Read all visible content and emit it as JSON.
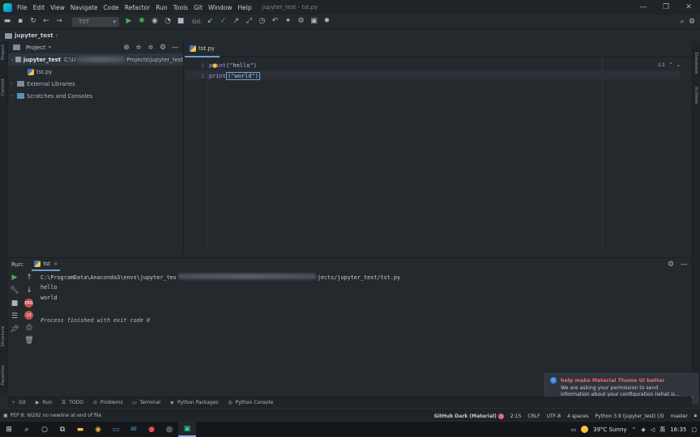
{
  "window": {
    "title": "jupyter_test - tst.py",
    "controls": [
      "—",
      "❐",
      "✕"
    ]
  },
  "menu": [
    "File",
    "Edit",
    "View",
    "Navigate",
    "Code",
    "Refactor",
    "Run",
    "Tools",
    "Git",
    "Window",
    "Help"
  ],
  "toolbar": {
    "run_config": "TST",
    "git_label": "Git:"
  },
  "breadcrumb": "jupyter_test",
  "left_strip": {
    "project": "Project",
    "commit": "Commit",
    "structure": "Structure",
    "favorites": "Favorites"
  },
  "right_strip": {
    "database": "Database",
    "sciview": "SciView"
  },
  "project": {
    "header": "Project",
    "root": {
      "name": "jupyter_test",
      "path_prefix": "C:\\U",
      "path_suffix": "Projects\\jupyter_test"
    },
    "items": [
      {
        "name": "tst.py"
      },
      {
        "name": "External Libraries"
      },
      {
        "name": "Scratches and Consoles"
      }
    ]
  },
  "editor": {
    "tab": "tst.py",
    "lines": [
      {
        "num": "1",
        "code_kw": "print",
        "code_rest": "(\"hello\")"
      },
      {
        "num": "2",
        "code_kw": "print",
        "code_rest": "(\"world\")"
      }
    ],
    "warnings": "⚠1"
  },
  "run_panel": {
    "title": "Run:",
    "tab": "tst",
    "badge1": "ERR",
    "badge2": "13",
    "output": {
      "cmd_prefix": "C:\\ProgramData\\Anaconda3\\envs\\jupyter_tes",
      "cmd_suffix": "jects/jupyter_test/tst.py",
      "line1": "hello",
      "line2": "world",
      "finish": "Process finished with exit code 0"
    }
  },
  "notification": {
    "title": "help make Material Theme UI better",
    "body1": "We are asking your permission to send",
    "body2": "information about your configuration (what is..."
  },
  "tool_tabs": [
    {
      "icon": "git-icon",
      "label": "Git"
    },
    {
      "icon": "run-icon",
      "label": "Run"
    },
    {
      "icon": "todo-icon",
      "label": "TODO"
    },
    {
      "icon": "problems-icon",
      "label": "Problems"
    },
    {
      "icon": "terminal-icon",
      "label": "Terminal"
    },
    {
      "icon": "packages-icon",
      "label": "Python Packages"
    },
    {
      "icon": "console-icon",
      "label": "Python Console"
    }
  ],
  "status": {
    "message": "PEP 8: W292 no newline at end of file",
    "theme": "GitHub Dark (Material)",
    "position": "2:15",
    "line_ending": "CRLF",
    "encoding": "UTF-8",
    "indent": "4 spaces",
    "interpreter": "Python 3.9 (jupyter_test) (3)",
    "branch": "master"
  },
  "taskbar": {
    "weather": "39°C  Sunny",
    "time": "16:35"
  }
}
